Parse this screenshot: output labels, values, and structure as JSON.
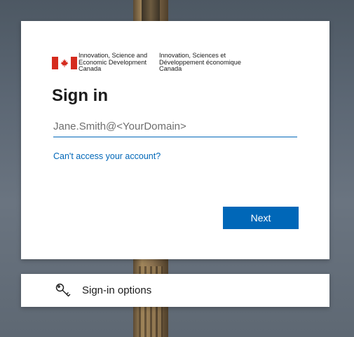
{
  "logo": {
    "english_text": "Innovation, Science and\nEconomic Development\nCanada",
    "french_text": "Innovation, Sciences et\nDéveloppement économique\nCanada"
  },
  "signin": {
    "title": "Sign in",
    "email_placeholder": "Jane.Smith@<YourDomain>",
    "email_value": "",
    "cant_access_link": "Can't access your account?",
    "next_label": "Next"
  },
  "options": {
    "icon": "key-icon",
    "label": "Sign-in options"
  },
  "colors": {
    "accent": "#0067b8",
    "flag_red": "#d52b1e",
    "card_bg": "#ffffff"
  }
}
